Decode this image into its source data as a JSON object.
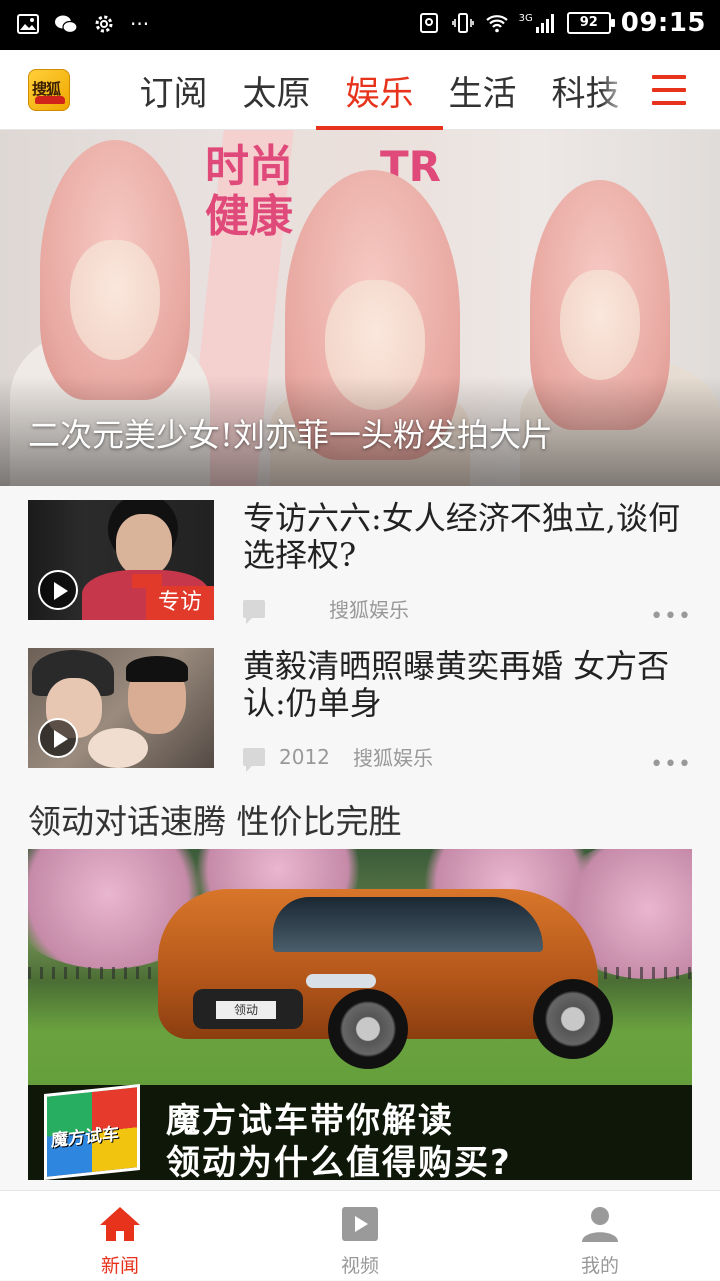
{
  "status_bar": {
    "time": "09:15",
    "battery": "92",
    "network": "3G"
  },
  "top_nav": {
    "logo_text": "搜狐",
    "tabs": [
      {
        "label": "订阅",
        "active": false
      },
      {
        "label": "太原",
        "active": false
      },
      {
        "label": "娱乐",
        "active": true
      },
      {
        "label": "生活",
        "active": false
      },
      {
        "label": "科技",
        "active": false
      }
    ],
    "accent_color": "#e8331c"
  },
  "hero": {
    "magazine_text_1": "时尚",
    "magazine_text_2": "健康",
    "magazine_text_3": "TR",
    "caption": "二次元美少女!刘亦菲一头粉发拍大片"
  },
  "news": [
    {
      "title": "专访六六:女人经济不独立,谈何选择权?",
      "thumb_tag": "专访",
      "comments": "",
      "source": "搜狐娱乐",
      "more": "•••"
    },
    {
      "title": "黄毅清晒照曝黄奕再婚 女方否认:仍单身",
      "comments": "2012",
      "source": "搜狐娱乐",
      "more": "•••"
    }
  ],
  "ad": {
    "title": "领动对话速腾 性价比完胜",
    "cube_text": "魔方试车",
    "banner_line1": "魔方试车带你解读",
    "banner_line2": "领动为什么值得购买?",
    "plate_text": "领动"
  },
  "bottom_tabs": [
    {
      "label": "新闻",
      "icon": "home-icon",
      "active": true
    },
    {
      "label": "视频",
      "icon": "video-icon",
      "active": false
    },
    {
      "label": "我的",
      "icon": "person-icon",
      "active": false
    }
  ]
}
